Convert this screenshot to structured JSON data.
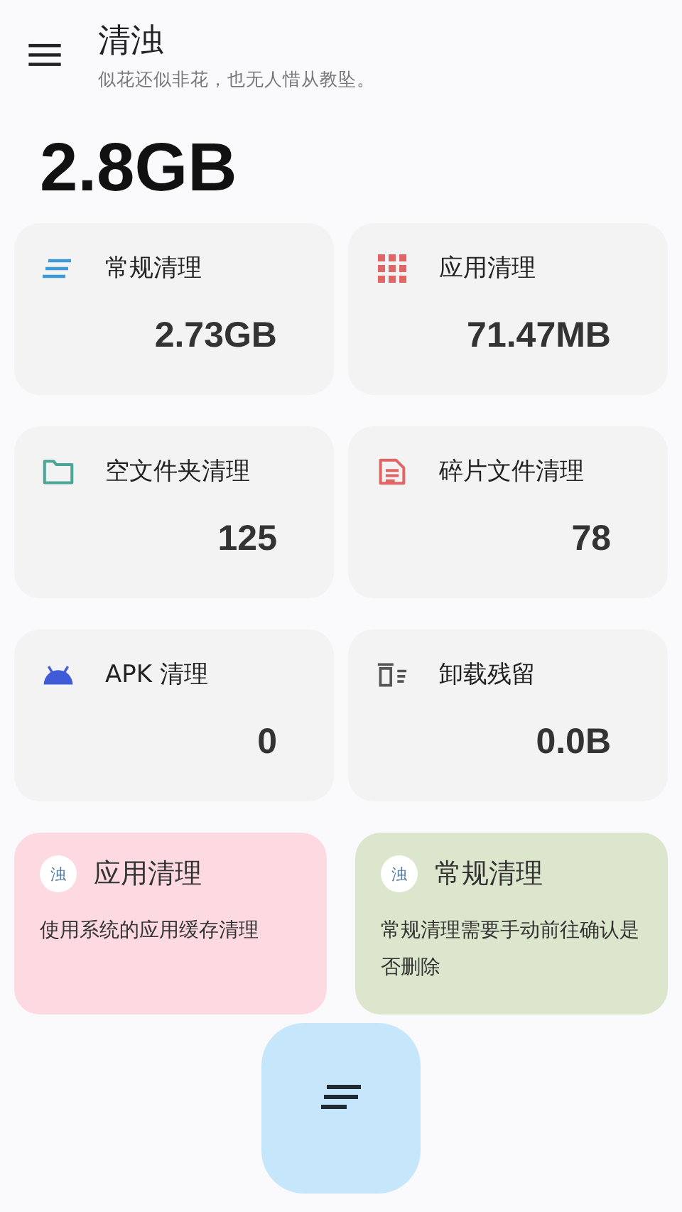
{
  "header": {
    "title": "清浊",
    "subtitle": "似花还似非花，也无人惜从教坠。"
  },
  "total": "2.8GB",
  "tiles": [
    {
      "kind": "lines",
      "label": "常规清理",
      "value": "2.73GB"
    },
    {
      "kind": "grid",
      "label": "应用清理",
      "value": "71.47MB"
    },
    {
      "kind": "folder",
      "label": "空文件夹清理",
      "value": "125"
    },
    {
      "kind": "document",
      "label": "碎片文件清理",
      "value": "78"
    },
    {
      "kind": "android",
      "label": "APK 清理",
      "value": "0"
    },
    {
      "kind": "trash",
      "label": "卸载残留",
      "value": "0.0B"
    }
  ],
  "cards": [
    {
      "badge": "浊",
      "title": "应用清理",
      "text": "使用系统的应用缓存清理",
      "color": "#fdd9e1"
    },
    {
      "badge": "浊",
      "title": "常规清理",
      "text": "常规清理需要手动前往确认是否删除",
      "color": "#dce6cd"
    }
  ]
}
